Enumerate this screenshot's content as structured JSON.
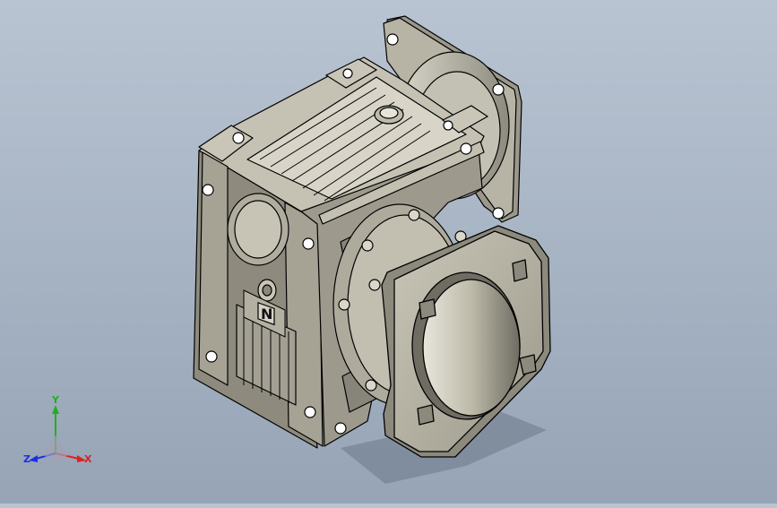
{
  "viewport": {
    "background_top": "#b9c4d2",
    "background_bottom": "#96a4b6",
    "model_color": "#b8b5a6",
    "edge_color": "#000000"
  },
  "triad": {
    "x_label": "X",
    "y_label": "Y",
    "z_label": "Z",
    "x_color": "#e02020",
    "y_color": "#20b020",
    "z_color": "#2030e0"
  },
  "nameplate": {
    "text": "N"
  }
}
